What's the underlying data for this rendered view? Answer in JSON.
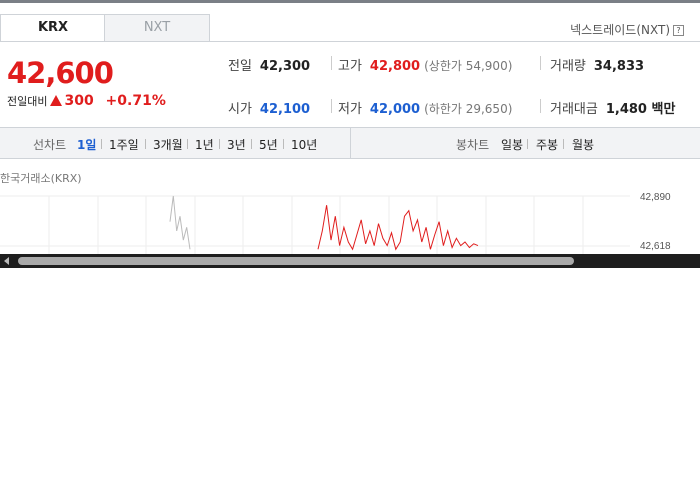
{
  "market_tabs": [
    {
      "label": "KRX",
      "active": true
    },
    {
      "label": "NXT",
      "active": false
    }
  ],
  "nextrade_link": "넥스트레이드(NXT)",
  "help_icon": "?",
  "price": {
    "current": "42,600",
    "change_label": "전일대비",
    "change_value": "300",
    "change_pct": "+0.71%"
  },
  "stats": {
    "prev_close": {
      "label": "전일",
      "value": "42,300"
    },
    "high": {
      "label": "고가",
      "value": "42,800",
      "limit": "(상한가 54,900)"
    },
    "volume": {
      "label": "거래량",
      "value": "34,833"
    },
    "open": {
      "label": "시가",
      "value": "42,100"
    },
    "low": {
      "label": "저가",
      "value": "42,000",
      "limit": "(하한가 29,650)"
    },
    "amount": {
      "label": "거래대금",
      "value": "1,480 백만"
    }
  },
  "line_chart": {
    "label": "선차트",
    "periods": [
      "1일",
      "1주일",
      "3개월",
      "1년",
      "3년",
      "5년",
      "10년"
    ],
    "active": "1일"
  },
  "candle_chart": {
    "label": "봉차트",
    "periods": [
      "일봉",
      "주봉",
      "월봉"
    ]
  },
  "chart": {
    "title": "한국거래소(KRX)",
    "y_ticks": [
      "42,890",
      "42,618"
    ],
    "prev_series": [
      42750,
      42890,
      42700,
      42780,
      42650,
      42720,
      42600
    ],
    "series": [
      42600,
      42700,
      42840,
      42650,
      42780,
      42620,
      42720,
      42640,
      42600,
      42680,
      42760,
      42630,
      42700,
      42620,
      42740,
      42660,
      42620,
      42690,
      42600,
      42640,
      42780,
      42810,
      42700,
      42760,
      42640,
      42720,
      42600,
      42680,
      42750,
      42620,
      42700,
      42610,
      42660,
      42620,
      42640,
      42610,
      42630,
      42620
    ]
  },
  "colors": {
    "up": "#e01d1d",
    "down": "#1d5fd1",
    "active": "#1d5fd1"
  }
}
